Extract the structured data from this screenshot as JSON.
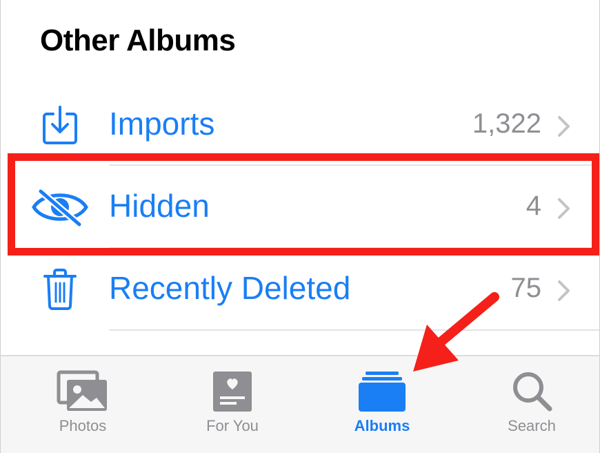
{
  "section": {
    "title": "Other Albums"
  },
  "rows": [
    {
      "label": "Imports",
      "count": "1,322",
      "icon": "import-icon"
    },
    {
      "label": "Hidden",
      "count": "4",
      "icon": "hidden-eye-slash-icon"
    },
    {
      "label": "Recently Deleted",
      "count": "75",
      "icon": "trash-icon"
    }
  ],
  "tabbar": {
    "tabs": [
      {
        "label": "Photos",
        "icon": "photos-icon",
        "active": false
      },
      {
        "label": "For You",
        "icon": "for-you-icon",
        "active": false
      },
      {
        "label": "Albums",
        "icon": "albums-icon",
        "active": true
      },
      {
        "label": "Search",
        "icon": "search-icon",
        "active": false
      }
    ]
  },
  "colors": {
    "accent": "#1a7ef5",
    "secondary_text": "#8e8e93",
    "highlight": "#f5201a",
    "tabbar_bg": "#f6f6f6"
  }
}
